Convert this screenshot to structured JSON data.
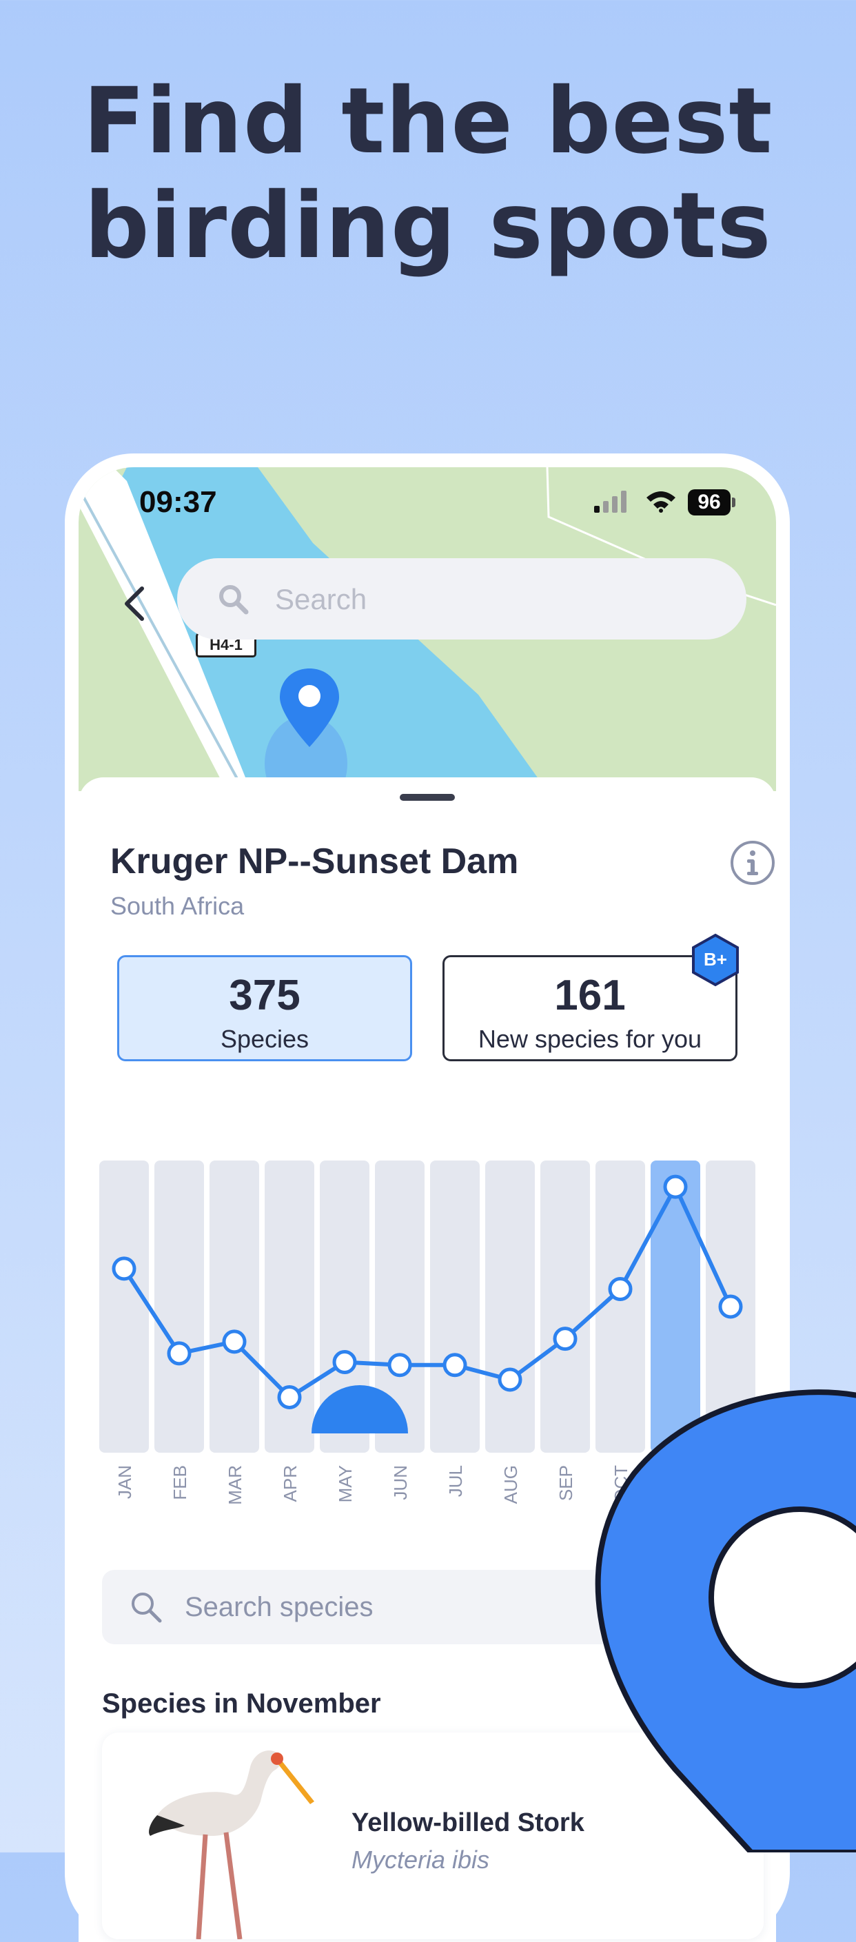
{
  "headline": {
    "line1": "Find the best",
    "line2": "birding spots"
  },
  "status_bar": {
    "time": "09:37",
    "battery": "96"
  },
  "map": {
    "search_placeholder": "Search",
    "road_label": "H4-1"
  },
  "location": {
    "title": "Kruger NP--Sunset Dam",
    "country": "South Africa"
  },
  "stats": {
    "species_count": "375",
    "species_label": "Species",
    "new_count": "161",
    "new_label": "New species for you",
    "badge": "B+"
  },
  "chart_data": {
    "type": "line",
    "categories": [
      "JAN",
      "FEB",
      "MAR",
      "APR",
      "MAY",
      "JUN",
      "JUL",
      "AUG",
      "SEP",
      "OCT",
      "NOV",
      "DEC"
    ],
    "visible_tick_labels": [
      "JAN",
      "FEB",
      "MAR",
      "APR",
      "MAY",
      "JUN",
      "JUL",
      "AUG",
      "SEP",
      "OCT"
    ],
    "values": [
      0.63,
      0.34,
      0.38,
      0.19,
      0.31,
      0.3,
      0.3,
      0.25,
      0.39,
      0.56,
      0.91,
      0.5
    ],
    "selected_month": "NOV",
    "ylim": [
      0,
      1
    ],
    "grid": false,
    "colors": {
      "line": "#2d82ef",
      "bar": "#e4e7ef",
      "bar_selected": "#8fbcf8"
    }
  },
  "species_search": {
    "placeholder": "Search species"
  },
  "section_title": "Species in November",
  "species_list": [
    {
      "common_name": "Yellow-billed Stork",
      "scientific_name": "Mycteria ibis"
    }
  ],
  "colors": {
    "accent": "#2d82ef",
    "pin": "#3f86f5",
    "text": "#272b3f",
    "muted": "#8891ad"
  }
}
